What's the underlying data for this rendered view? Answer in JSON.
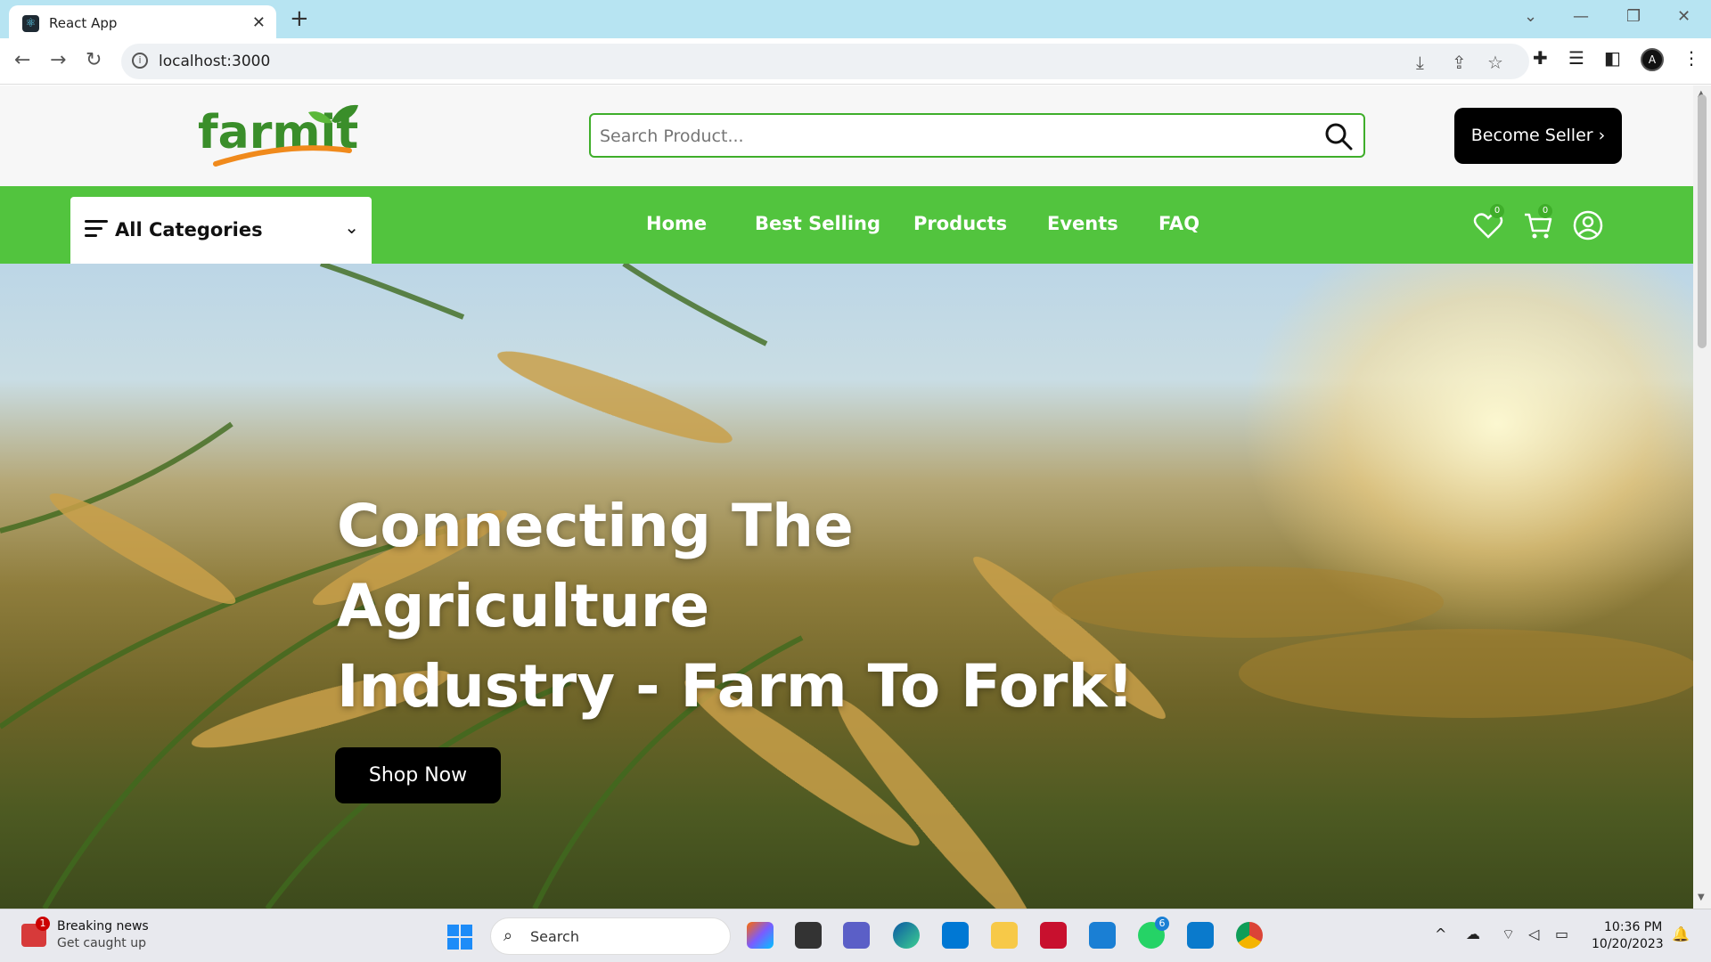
{
  "browser": {
    "tab_title": "React App",
    "url": "localhost:3000"
  },
  "site": {
    "logo_text": "farmit",
    "search_placeholder": "Search Product...",
    "become_seller_label": "Become Seller",
    "categories_label": "All Categories",
    "nav_links": [
      "Home",
      "Best Selling",
      "Products",
      "Events",
      "FAQ"
    ],
    "wishlist_count": "0",
    "cart_count": "0",
    "hero_title_line1": "Connecting The Agriculture",
    "hero_title_line2": "Industry - Farm To Fork!",
    "shop_now_label": "Shop Now",
    "colors": {
      "brand_green": "#52c43e",
      "logo_orange": "#f08a1c",
      "logo_green": "#3a8e2a",
      "button_black": "#000000"
    }
  },
  "taskbar": {
    "news_title": "Breaking news",
    "news_subtitle": "Get caught up",
    "news_badge": "1",
    "search_label": "Search",
    "whatsapp_badge": "6",
    "time": "10:36 PM",
    "date": "10/20/2023"
  }
}
